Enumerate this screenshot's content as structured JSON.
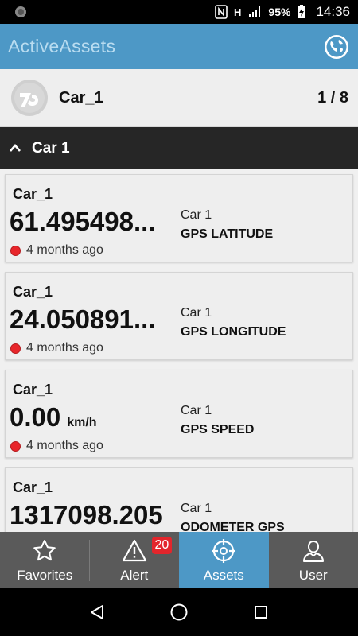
{
  "status_bar": {
    "battery": "95%",
    "time": "14:36",
    "network_label": "H"
  },
  "app": {
    "title": "ActiveAssets"
  },
  "asset": {
    "name": "Car_1",
    "pager": "1 / 8"
  },
  "group": {
    "label": "Car 1"
  },
  "cards": [
    {
      "title": "Car_1",
      "value": "61.495498...",
      "unit": "",
      "time": "4 months ago",
      "group": "Car 1",
      "param": "GPS LATITUDE"
    },
    {
      "title": "Car_1",
      "value": "24.050891...",
      "unit": "",
      "time": "4 months ago",
      "group": "Car 1",
      "param": "GPS LONGITUDE"
    },
    {
      "title": "Car_1",
      "value": "0.00",
      "unit": "km/h",
      "time": "4 months ago",
      "group": "Car 1",
      "param": "GPS SPEED"
    },
    {
      "title": "Car_1",
      "value": "1317098.205",
      "unit": "",
      "time": "",
      "group": "Car 1",
      "param": "ODOMETER GPS"
    }
  ],
  "bottom_nav": {
    "items": [
      {
        "label": "Favorites",
        "icon": "star-icon"
      },
      {
        "label": "Alert",
        "icon": "warning-icon",
        "badge": "20"
      },
      {
        "label": "Assets",
        "icon": "crosshair-icon"
      },
      {
        "label": "User",
        "icon": "user-icon"
      }
    ],
    "active": "Assets"
  },
  "colors": {
    "accent": "#4d98c6",
    "nav_bg": "#5a5a5a",
    "group_bg": "#262626",
    "status_dot": "#e8262b"
  }
}
